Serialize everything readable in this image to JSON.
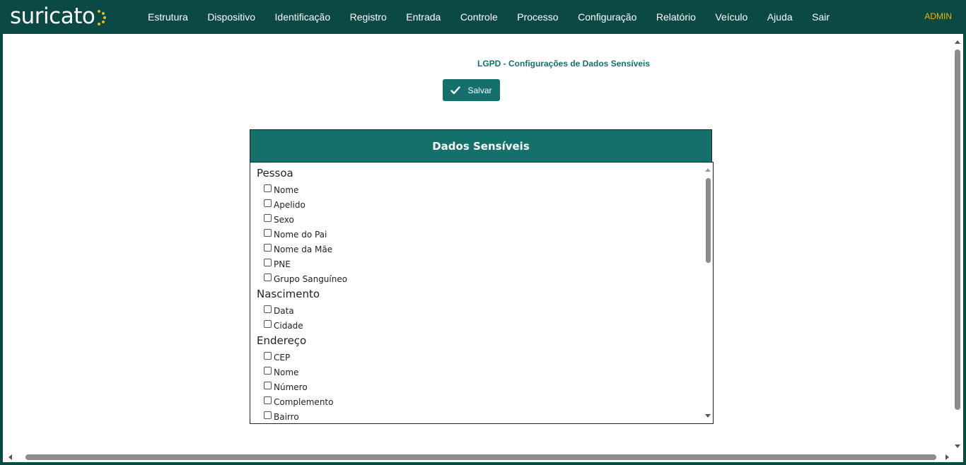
{
  "navbar": {
    "logo_text": "suricato",
    "items": [
      "Estrutura",
      "Dispositivo",
      "Identificação",
      "Registro",
      "Entrada",
      "Controle",
      "Processo",
      "Configuração",
      "Relatório",
      "Veículo",
      "Ajuda",
      "Sair"
    ],
    "user": "ADMIN"
  },
  "page": {
    "title": "LGPD - Configurações de Dados Sensíveis",
    "save_label": "Salvar"
  },
  "panel": {
    "header": "Dados Sensíveis",
    "sections": [
      {
        "title": "Pessoa",
        "fields": [
          "Nome",
          "Apelido",
          "Sexo",
          "Nome do Pai",
          "Nome da Mãe",
          "PNE",
          "Grupo Sanguíneo"
        ]
      },
      {
        "title": "Nascimento",
        "fields": [
          "Data",
          "Cidade"
        ]
      },
      {
        "title": "Endereço",
        "fields": [
          "CEP",
          "Nome",
          "Número",
          "Complemento",
          "Bairro"
        ]
      }
    ]
  },
  "colors": {
    "navbar_bg": "#0b4a44",
    "accent": "#14706b",
    "user_color": "#f0b400",
    "logo_dots": "#e8b923"
  }
}
